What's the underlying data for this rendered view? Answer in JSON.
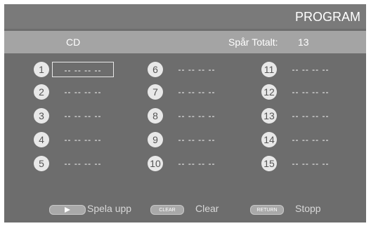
{
  "screen": {
    "title": "PROGRAM",
    "info": {
      "disc_type": "CD",
      "tracks_label": "Spår Totalt:",
      "tracks_value": "13"
    },
    "slots": [
      {
        "number": "1",
        "value": "-- -- -- --",
        "selected": true
      },
      {
        "number": "2",
        "value": "-- -- -- --",
        "selected": false
      },
      {
        "number": "3",
        "value": "-- -- -- --",
        "selected": false
      },
      {
        "number": "4",
        "value": "-- -- -- --",
        "selected": false
      },
      {
        "number": "5",
        "value": "-- -- -- --",
        "selected": false
      },
      {
        "number": "6",
        "value": "-- -- -- --",
        "selected": false
      },
      {
        "number": "7",
        "value": "-- -- -- --",
        "selected": false
      },
      {
        "number": "8",
        "value": "-- -- -- --",
        "selected": false
      },
      {
        "number": "9",
        "value": "-- -- -- --",
        "selected": false
      },
      {
        "number": "10",
        "value": "-- -- -- --",
        "selected": false
      },
      {
        "number": "11",
        "value": "-- -- -- --",
        "selected": false
      },
      {
        "number": "12",
        "value": "-- -- -- --",
        "selected": false
      },
      {
        "number": "13",
        "value": "-- -- -- --",
        "selected": false
      },
      {
        "number": "14",
        "value": "-- -- -- --",
        "selected": false
      },
      {
        "number": "15",
        "value": "-- -- -- --",
        "selected": false
      }
    ],
    "controls": {
      "play": {
        "icon": "play-icon",
        "label": "Spela upp"
      },
      "clear": {
        "button_text": "CLEAR",
        "label": "Clear"
      },
      "return": {
        "button_text": "RETURN",
        "label": "Stopp"
      }
    },
    "colors": {
      "background": "#6d6d6d",
      "info_bar": "#a4a4a4",
      "number_circle": "#e8e8e8"
    }
  }
}
